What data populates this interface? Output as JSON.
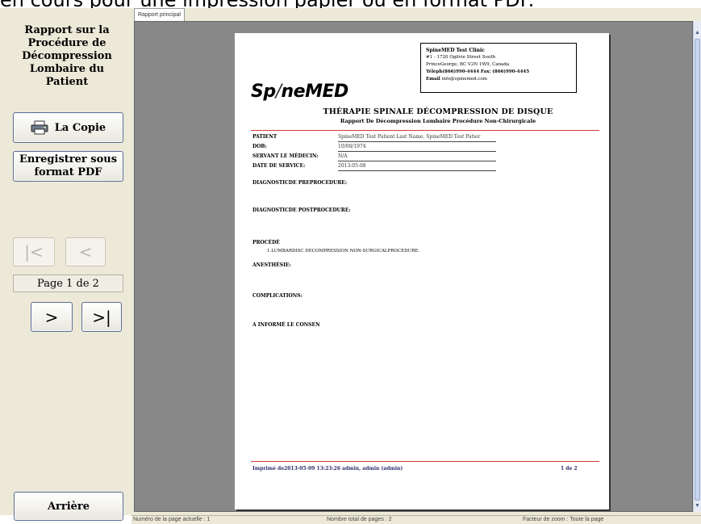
{
  "top_caption": "en cours pour une impression papier ou en format PDF.",
  "left_panel": {
    "title": "Rapport sur la Procédure de Décompression Lombaire du Patient",
    "print_button": "La Copie",
    "pdf_button": "Enregistrer sous format PDF",
    "first_button": "|<",
    "prev_button": "<",
    "page_indicator": "Page 1 de 2",
    "next_button": ">",
    "last_button": ">|",
    "back_button": "Arrière"
  },
  "viewer": {
    "tab_label": "Rapport principal"
  },
  "document": {
    "clinic_name": "SpineMED Test Clinic",
    "clinic_address_1": "#1 - 1720 Ogilvie Street South",
    "clinic_address_2": "PrinceGeorge, BC V2N 1W9, Canada",
    "clinic_phone": "Téléph(866)990-4444",
    "clinic_fax": "Fax: (866)990-4445",
    "clinic_email_label": "Email",
    "clinic_email": "info@spinemed.com",
    "logo_left": "Sp",
    "logo_slash": "/",
    "logo_right": "neMED",
    "title": "THÉRAPIE SPINALE DÉCOMPRESSION DE DISQUE",
    "subtitle": "Rapport De Décompression Lombaire Procédure Non-Chirurgicale",
    "fields": [
      {
        "label": "PATIENT",
        "value": "SpineMED Test Patient Last Name, SpineMED Test Patier"
      },
      {
        "label": "DOB:",
        "value": "10/08/1974"
      },
      {
        "label": "SERVANT LE MÉDECIN:",
        "value": "N/A"
      },
      {
        "label": "DATE DE SERVICE:",
        "value": "2013-05-08"
      }
    ],
    "pre_diagnosis": "DIAGNOSTICDE PREPROCEDURE:",
    "post_diagnosis": "DIAGNOSTICDE POSTPROCEDURE:",
    "procedure_label": "PROCÉDÉ",
    "procedure_item": "1.LUMBARDISC DECOMPRESSION NON-SURGICALPROCEDURE.",
    "anesthesia": "ANESTHÉSIE:",
    "complications": "COMPLICATIONS:",
    "consent": "A INFORMÉ LE CONSEN",
    "footer": "Imprimé de2013-05-09 13:23:26 admin, admin (admin)",
    "footer_page": "1 de 2"
  },
  "status_bar": {
    "current_page": "Numéro de la page actuelle : 1",
    "total_pages": "Nombre total de pages : 2",
    "zoom": "Facteur de zoom : Toute la page"
  }
}
